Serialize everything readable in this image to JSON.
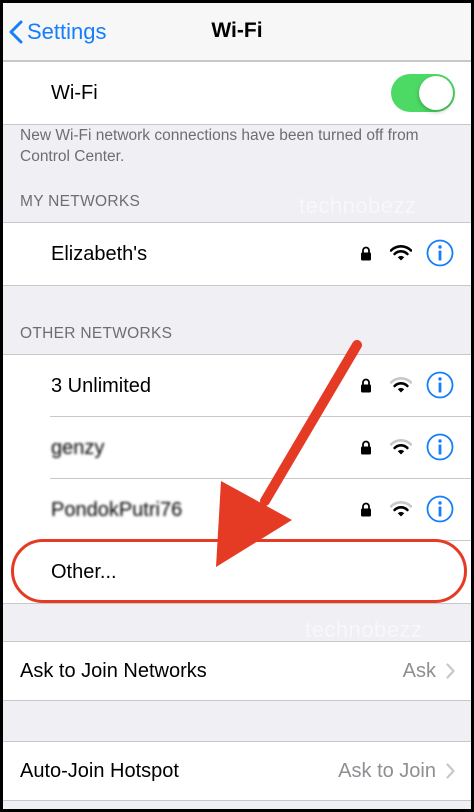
{
  "navbar": {
    "back_label": "Settings",
    "title": "Wi-Fi"
  },
  "wifi": {
    "label": "Wi-Fi",
    "enabled": true
  },
  "footnote": "New Wi-Fi network connections have been turned off from Control Center.",
  "my_networks": {
    "header": "MY NETWORKS",
    "items": [
      {
        "name": "Elizabeth's"
      }
    ]
  },
  "other_networks": {
    "header": "OTHER NETWORKS",
    "items": [
      {
        "name": "3 Unlimited"
      },
      {
        "name": "genzy"
      },
      {
        "name": "PondokPutri76"
      }
    ],
    "other_label": "Other..."
  },
  "ask_to_join": {
    "label": "Ask to Join Networks",
    "value": "Ask"
  },
  "auto_join": {
    "label": "Auto-Join Hotspot",
    "value": "Ask to Join"
  },
  "watermark": "technobezz",
  "colors": {
    "accent": "#157efb",
    "toggle_on": "#4cd964",
    "annotation": "#e53a23"
  }
}
